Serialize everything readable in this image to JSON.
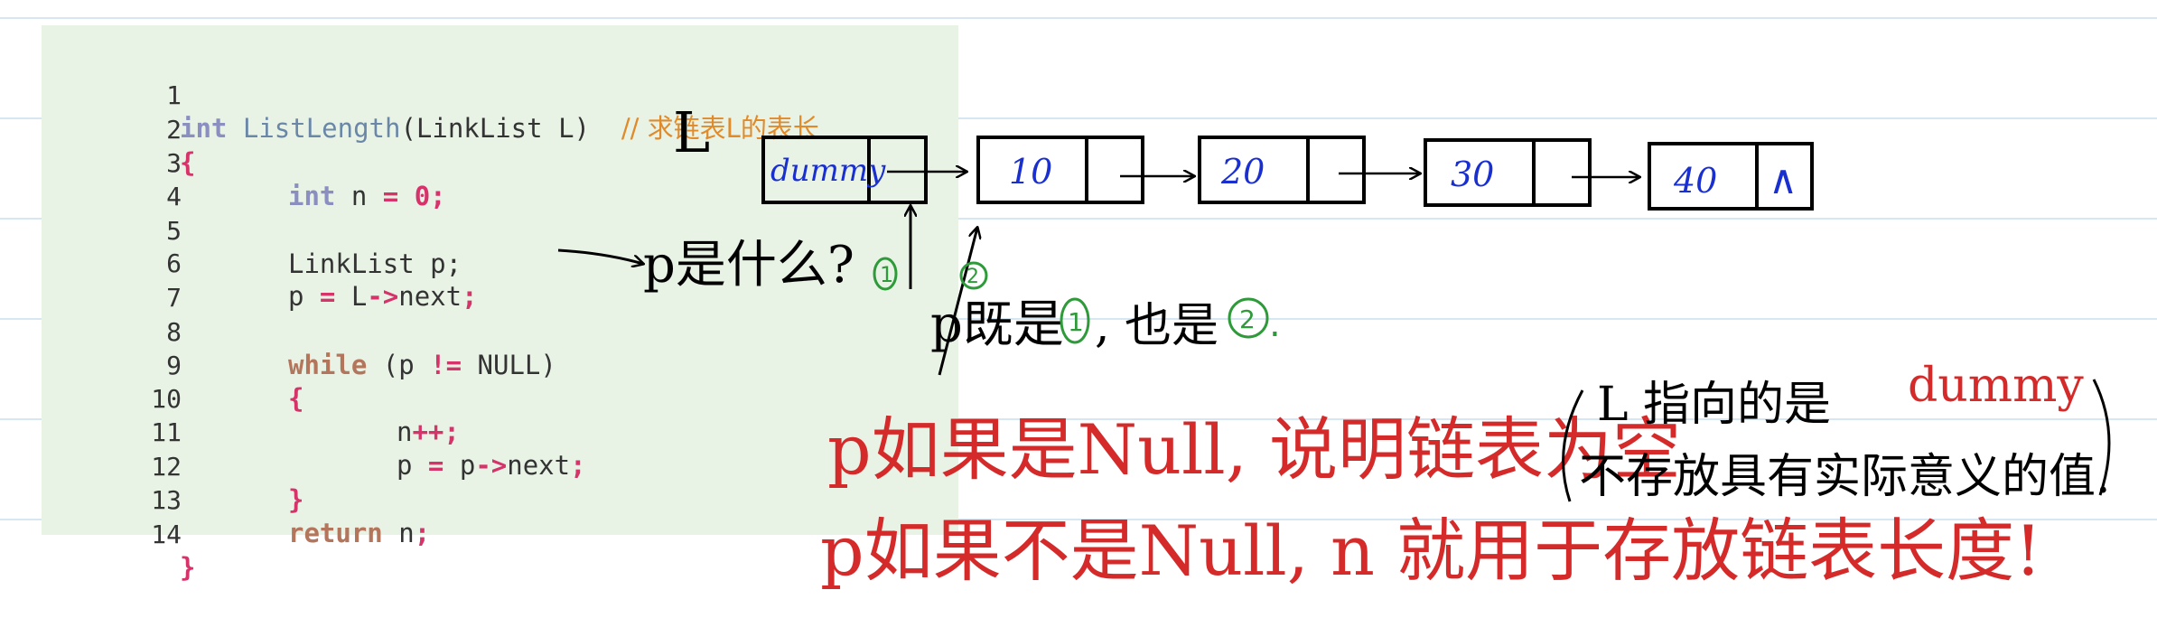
{
  "code": {
    "lines": [
      {
        "n": "1",
        "text": ""
      },
      {
        "n": "2",
        "text": "{"
      },
      {
        "n": "3",
        "text": ""
      },
      {
        "n": "4",
        "text": ""
      },
      {
        "n": "5",
        "text": "LinkList p;"
      },
      {
        "n": "6",
        "text": ""
      },
      {
        "n": "7",
        "text": ""
      },
      {
        "n": "8",
        "text": ""
      },
      {
        "n": "9",
        "text": "{"
      },
      {
        "n": "10",
        "text": ""
      },
      {
        "n": "11",
        "text": ""
      },
      {
        "n": "12",
        "text": "}"
      },
      {
        "n": "13",
        "text": ""
      },
      {
        "n": "14",
        "text": "}"
      }
    ],
    "line1": {
      "kw": "int",
      "fn": "ListLength",
      "rest": "(LinkList L)",
      "comment": "// 求链表L的表长"
    },
    "line3": {
      "kw": "int",
      "rest": " n ",
      "eq": "=",
      "num": " 0",
      "semi": ";"
    },
    "line6": {
      "a": "p ",
      "eq": "=",
      "b": " L",
      "arrow": "->",
      "c": "next",
      "semi": ";"
    },
    "line8": {
      "kw": "while",
      "a": " (p ",
      "ne": "!=",
      "b": " NULL)"
    },
    "line10": {
      "a": "n",
      "pp": "++",
      "semi": ";"
    },
    "line11": {
      "a": "p ",
      "eq": "=",
      "b": " p",
      "arrow": "->",
      "c": "next",
      "semi": ";"
    },
    "line13": {
      "kw": "return",
      "a": " n",
      "semi": ";"
    }
  },
  "diagram": {
    "label_L": "L",
    "nodes": [
      "dummy",
      "10",
      "20",
      "30",
      "40"
    ],
    "last_next": "∧"
  },
  "notes": {
    "p_question": "p是什么?",
    "mark1": "1",
    "mark2": "2",
    "p_is_both": "p既是",
    "also_is": ", 也是",
    "period": ".",
    "if_null": "p如果是Null, 说明链表为空",
    "aside_line1_a": "L 指向的是",
    "aside_dummy": "dummy",
    "aside_line2": "不存放具有实际意义的值.",
    "if_not_null": "p如果不是Null, n 就用于存放链表长度!"
  }
}
